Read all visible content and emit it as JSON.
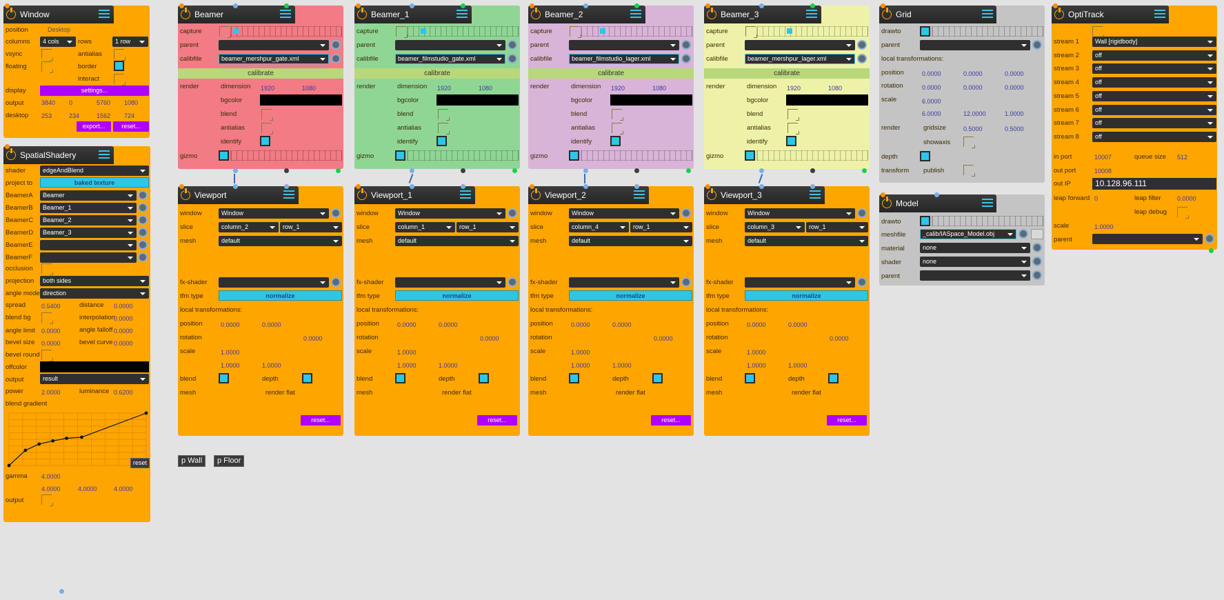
{
  "window": {
    "title": "Window",
    "position_label": "position",
    "position_value": "Desktop",
    "columns_label": "columns",
    "columns_value": "4 cols",
    "rows_label": "rows",
    "rows_value": "1 row",
    "vsync_label": "vsync",
    "antialias_label": "antialias",
    "floating_label": "floating",
    "border_label": "border",
    "interact_label": "interact",
    "display_label": "display",
    "display_btn": "settings...",
    "output_label": "output",
    "output_values": [
      "3840",
      "0",
      "5760",
      "1080"
    ],
    "desktop_label": "desktop",
    "desktop_values": [
      "253",
      "234",
      "1562",
      "724"
    ],
    "export_btn": "export...",
    "reset_btn": "reset..."
  },
  "shadery": {
    "title": "SpatialShadery",
    "shader_label": "shader",
    "shader_value": "edgeAndBlend",
    "project_label": "project to",
    "project_value": "baked texture",
    "beamers": [
      {
        "label": "BeamerA",
        "value": "Beamer"
      },
      {
        "label": "BeamerB",
        "value": "Beamer_1"
      },
      {
        "label": "BeamerC",
        "value": "Beamer_2"
      },
      {
        "label": "BeamerD",
        "value": "Beamer_3"
      },
      {
        "label": "BeamerE",
        "value": ""
      },
      {
        "label": "BeamerF",
        "value": ""
      }
    ],
    "occlusion_label": "occlusion",
    "projection_label": "projection",
    "projection_value": "both sides",
    "angle_mode_label": "angle mode",
    "angle_mode_value": "direction",
    "spread_label": "spread",
    "spread_value": "0.5400",
    "distance_label": "distance",
    "distance_value": "0.0000",
    "blendbg_label": "blend bg",
    "interpolation_label": "interpolation",
    "interpolation_value": "0.0000",
    "anglelimit_label": "angle limit",
    "anglelimit_value": "0.0000",
    "anglefalloff_label": "angle falloff",
    "anglefalloff_value": "0.0000",
    "bevelsize_label": "bevel size",
    "bevelsize_value": "0.0000",
    "bevelcurve_label": "bevel curve",
    "bevelcurve_value": "0.0000",
    "bevelround_label": "bevel round",
    "offcolor_label": "offcolor",
    "output_label": "output",
    "output_value": "result",
    "power_label": "power",
    "power_value": "2.0000",
    "luminance_label": "luminance",
    "luminance_value": "0.6200",
    "gradient_label": "blend gradient",
    "gradient_reset": "reset",
    "gradient_points": [
      [
        0,
        0
      ],
      [
        0.12,
        0.29
      ],
      [
        0.22,
        0.41
      ],
      [
        0.32,
        0.47
      ],
      [
        0.42,
        0.52
      ],
      [
        0.53,
        0.54
      ],
      [
        1.0,
        1.0
      ]
    ],
    "gamma_label": "gamma",
    "gamma_values": [
      "4.0000",
      "4.0000",
      "4.0000",
      "4.0000"
    ],
    "output2_label": "output"
  },
  "beamers": [
    {
      "title": "Beamer",
      "calibfile": "beamer_mershpur_gate.xml",
      "dim_w": "1920",
      "dim_h": "1080"
    },
    {
      "title": "Beamer_1",
      "calibfile": "beamer_filmstudio_gate.xml",
      "dim_w": "1920",
      "dim_h": "1080"
    },
    {
      "title": "Beamer_2",
      "calibfile": "beamer_filmstudio_lager.xml",
      "dim_w": "1920",
      "dim_h": "1080"
    },
    {
      "title": "Beamer_3",
      "calibfile": "beamer_mershpur_lager.xml",
      "dim_w": "1920",
      "dim_h": "1080"
    }
  ],
  "beamer_labels": {
    "capture": "capture",
    "parent": "parent",
    "calibfile": "calibfile",
    "calibrate": "calibrate",
    "render": "render",
    "dimension": "dimension",
    "bgcolor": "bgcolor",
    "blend": "blend",
    "antialias": "antialias",
    "identify": "identify",
    "gizmo": "gizmo"
  },
  "viewports": [
    {
      "title": "Viewport",
      "window": "Window",
      "col": "column_2",
      "row": "row_1",
      "mesh": "default"
    },
    {
      "title": "Viewport_1",
      "window": "Window",
      "col": "column_1",
      "row": "row_1",
      "mesh": "default"
    },
    {
      "title": "Viewport_2",
      "window": "Window",
      "col": "column_4",
      "row": "row_1",
      "mesh": "default"
    },
    {
      "title": "Viewport_3",
      "window": "Window",
      "col": "column_3",
      "row": "row_1",
      "mesh": "default"
    }
  ],
  "viewport_labels": {
    "window": "window",
    "slice": "slice",
    "mesh": "mesh",
    "fxshader": "fx-shader",
    "tfmtype": "tfm type",
    "tfmtype_value": "normalize",
    "localtf": "local transformations:",
    "position": "position",
    "rotation": "rotation",
    "scale": "scale",
    "pos_x": "0.0000",
    "pos_y": "0.0000",
    "rot": "0.0000",
    "scale_a": "1.0000",
    "scale_b": "1.0000",
    "scale_c": "1.0000",
    "blend": "blend",
    "depth": "depth",
    "mesh2": "mesh",
    "render_flat": "render flat",
    "reset": "reset..."
  },
  "grid": {
    "title": "Grid",
    "drawto": "drawto",
    "parent": "parent",
    "localtf": "local transformations:",
    "position": "position",
    "pos": [
      "0.0000",
      "0.0000",
      "0.0000"
    ],
    "rotation": "rotation",
    "rot": [
      "0.0000",
      "0.0000",
      "0.0000"
    ],
    "scale": "scale",
    "scale_a": "6.0000",
    "scale_vals": [
      "6.0000",
      "12.0000",
      "1.0000"
    ],
    "render": "render",
    "gridsize": "gridsize",
    "gridsize_vals": [
      "0.5000",
      "0.5000"
    ],
    "showaxis": "showaxis",
    "depth": "depth",
    "transform": "transform",
    "publish": "publish"
  },
  "model": {
    "title": "Model",
    "drawto": "drawto",
    "meshfile": "meshfile",
    "meshfile_value": "_calib/IASpace_Model.obj",
    "material": "material",
    "material_value": "none",
    "shader": "shader",
    "shader_value": "none",
    "parent": "parent"
  },
  "optitrack": {
    "title": "OptiTrack",
    "streams": [
      {
        "label": "stream 1",
        "value": "Wall [rigidbody]"
      },
      {
        "label": "stream 2",
        "value": "off"
      },
      {
        "label": "stream 3",
        "value": "off"
      },
      {
        "label": "stream 4",
        "value": "off"
      },
      {
        "label": "stream 5",
        "value": "off"
      },
      {
        "label": "stream 6",
        "value": "off"
      },
      {
        "label": "stream 7",
        "value": "off"
      },
      {
        "label": "stream 8",
        "value": "off"
      }
    ],
    "inport": "in port",
    "inport_value": "10007",
    "queue": "queue size",
    "queue_value": "512",
    "outport": "out port",
    "outport_value": "10008",
    "outip": "out IP",
    "outip_value": "10.128.96.111",
    "leapfwd": "leap forward",
    "leapfwd_value": "0",
    "leapfilter": "leap filter",
    "leapfilter_value": "0.0000",
    "leapdebug": "leap debug",
    "scale": "scale",
    "scale_value": "1.0000",
    "parent": "parent"
  },
  "buttons": {
    "wall": "p Wall",
    "floor": "p Floor"
  }
}
